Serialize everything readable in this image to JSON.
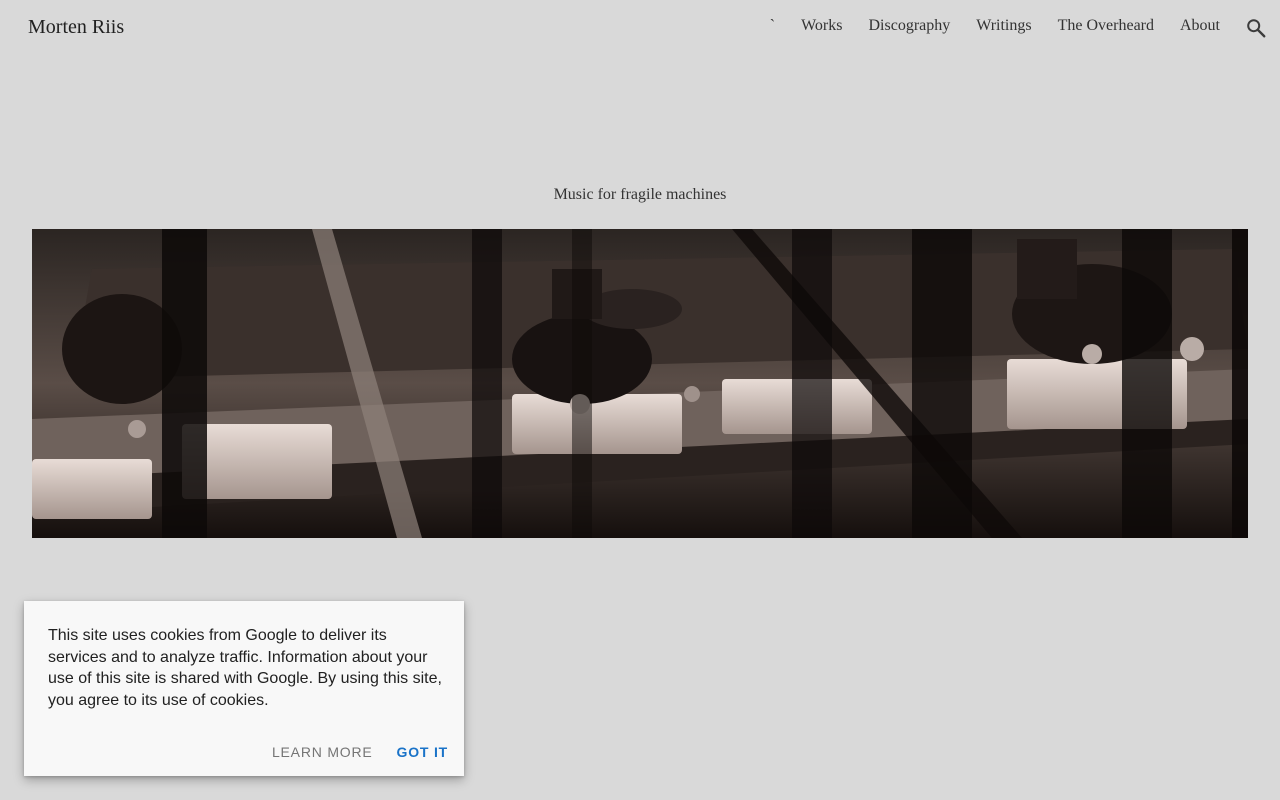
{
  "header": {
    "site_title": "Morten Riis",
    "nav": [
      "`",
      "Works",
      "Discography",
      "Writings",
      "The Overheard",
      "About"
    ]
  },
  "main": {
    "subtitle": "Music for fragile machines"
  },
  "cookie_banner": {
    "text": "This site uses cookies from Google to deliver its services and to analyze traffic. Information about your use of this site is shared with Google. By using this site, you agree to its use of cookies.",
    "learn_more": "LEARN MORE",
    "got_it": "GOT IT"
  },
  "icons": {
    "search": "search-icon"
  },
  "colors": {
    "background": "#d9d9d9",
    "accent": "#1a73c8"
  }
}
